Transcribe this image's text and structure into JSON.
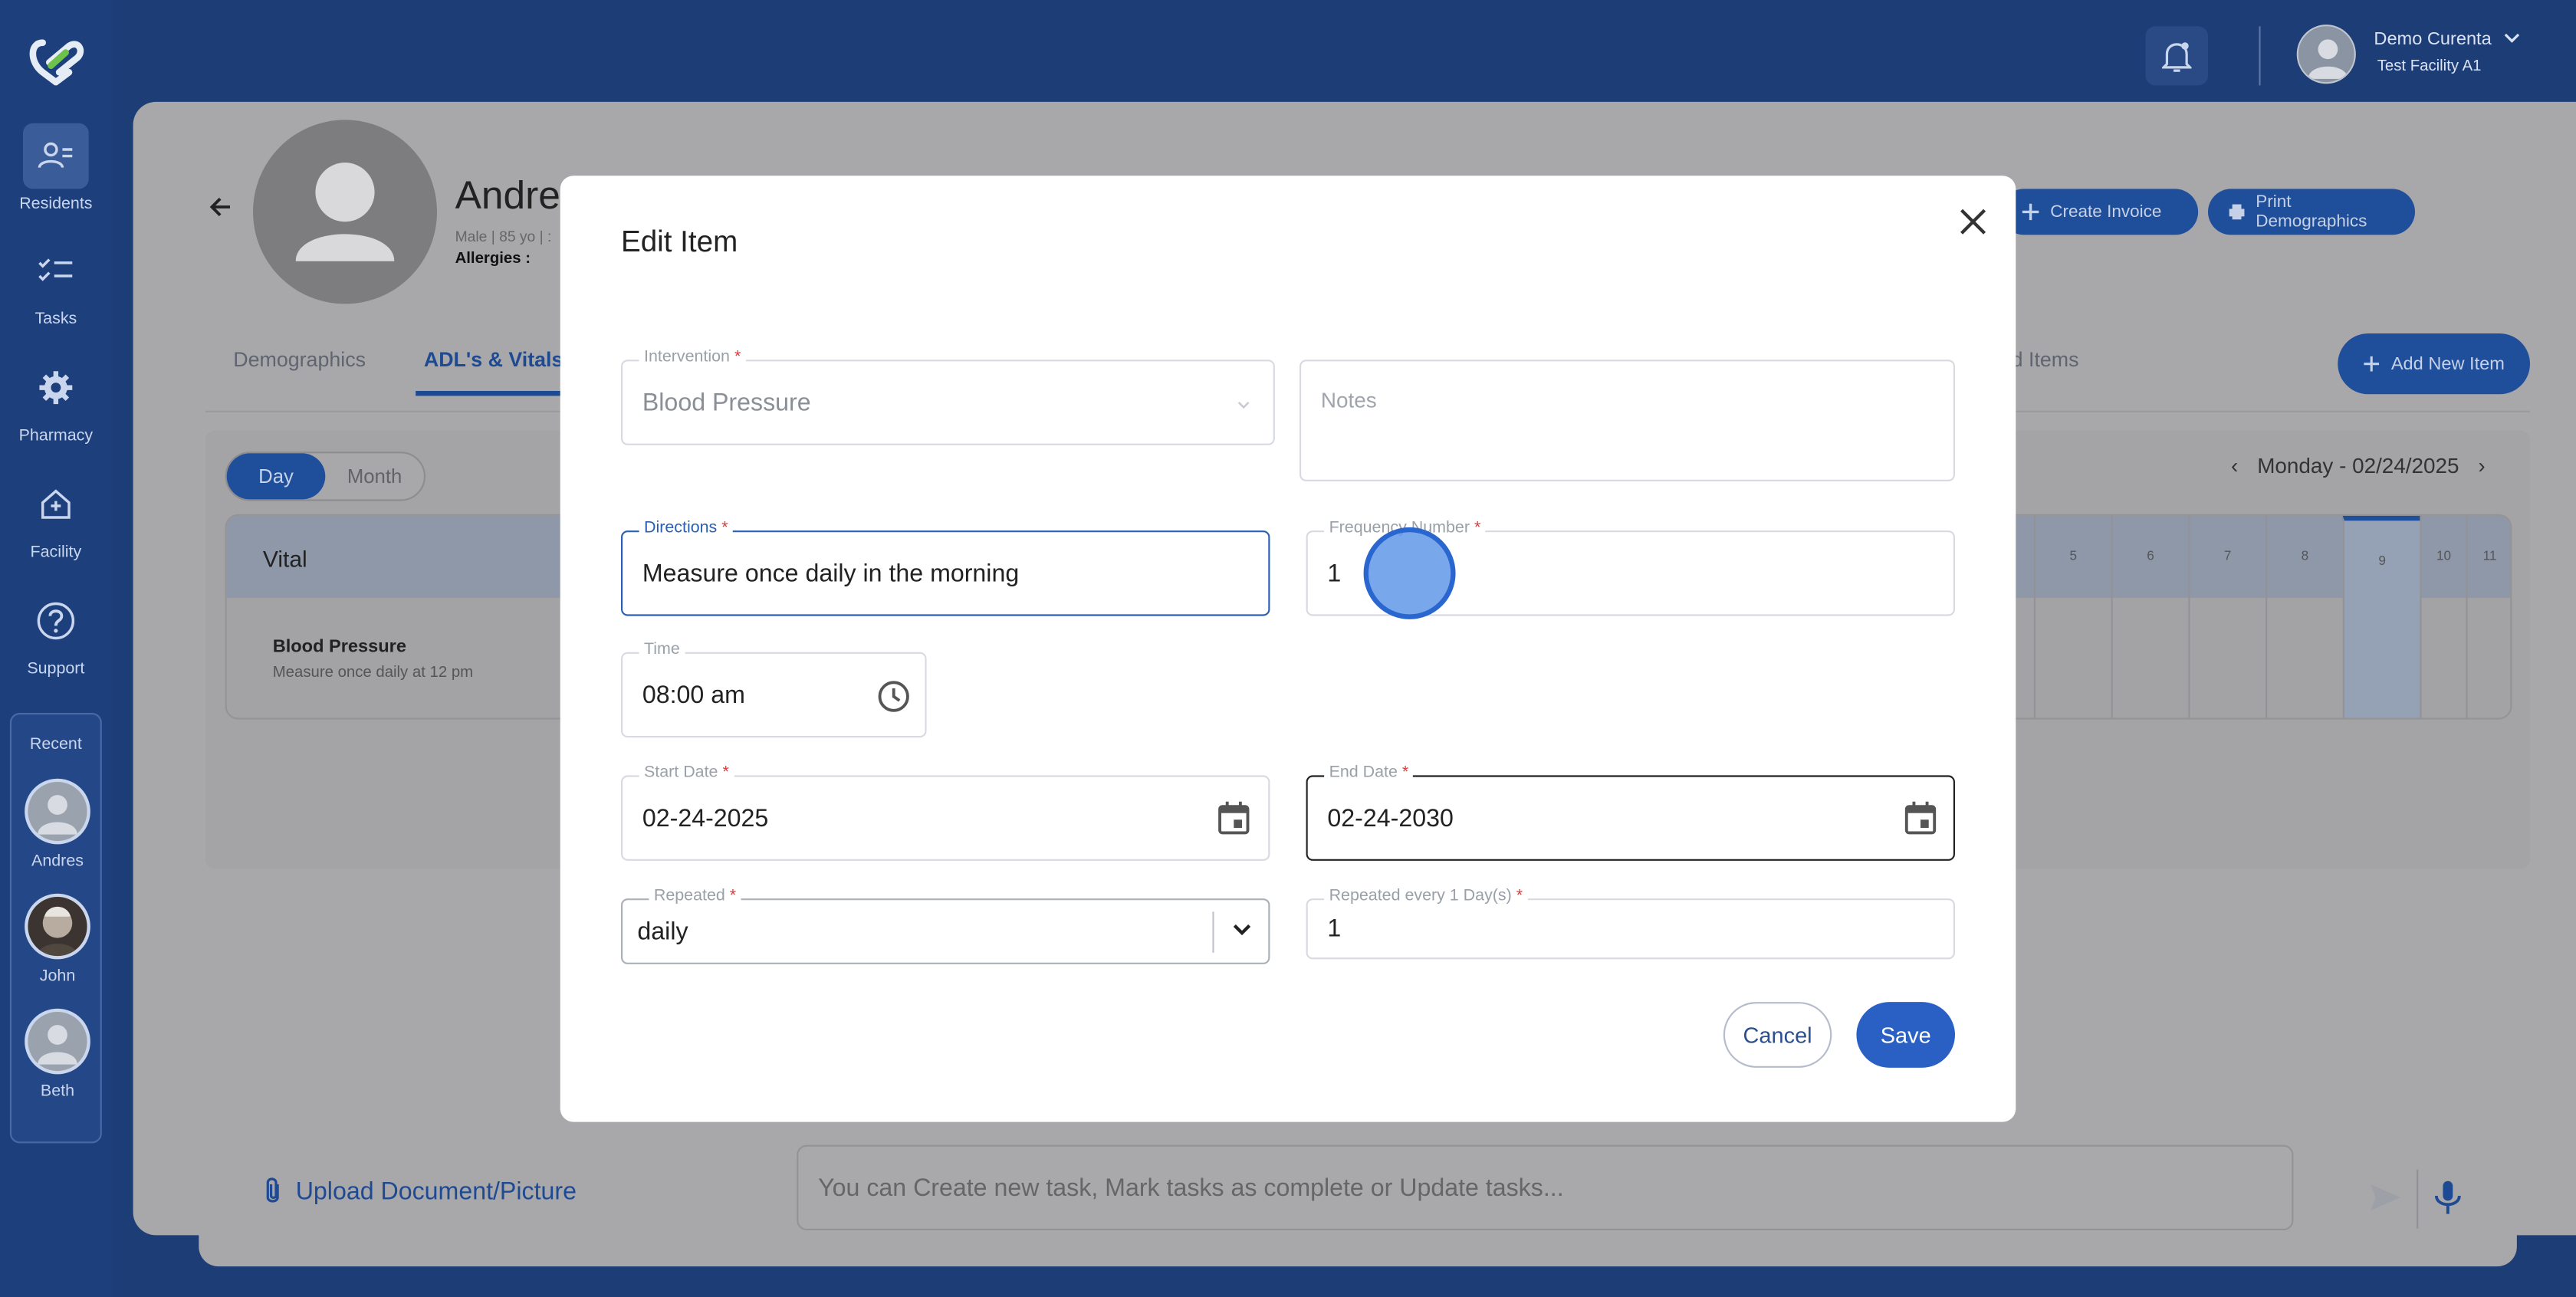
{
  "colors": {
    "sidebar": "#1d3f7c",
    "accent": "#2a60c4",
    "overlay_panel": "#a8a8aa"
  },
  "sidebar": {
    "items": [
      {
        "label": "Residents",
        "icon": "residents-icon"
      },
      {
        "label": "Tasks",
        "icon": "tasks-icon"
      },
      {
        "label": "Pharmacy",
        "icon": "gear-icon"
      },
      {
        "label": "Facility",
        "icon": "facility-icon"
      },
      {
        "label": "Support",
        "icon": "help-icon"
      }
    ],
    "recent": {
      "label": "Recent",
      "people": [
        "Andres",
        "John",
        "Beth"
      ]
    }
  },
  "header": {
    "user_name": "Demo Curenta",
    "facility": "Test Facility A1"
  },
  "resident": {
    "name": "Andres",
    "meta": "Male | 85 yo | :",
    "allergies_label": "Allergies :",
    "actions": {
      "create_invoice": "Create Invoice",
      "print_demographics": "Print Demographics"
    },
    "tabs": [
      "Demographics",
      "ADL's & Vitals"
    ],
    "completed_items": "eted Items",
    "add_new_item": "Add New Item",
    "view_toggle": {
      "day": "Day",
      "month": "Month"
    },
    "date_nav": "Monday - 02/24/2025",
    "table": {
      "header": "Vital",
      "hours": [
        "5",
        "6",
        "7",
        "8",
        "9",
        "10",
        "11"
      ],
      "row_title": "Blood Pressure",
      "row_sub": "Measure once daily at 12 pm"
    }
  },
  "bottom": {
    "upload_label": "Upload Document/Picture",
    "chat_placeholder": "You can Create new task, Mark tasks as complete or Update tasks..."
  },
  "modal": {
    "title": "Edit Item",
    "intervention": {
      "label": "Intervention",
      "value": "Blood Pressure"
    },
    "notes": {
      "placeholder": "Notes"
    },
    "directions": {
      "label": "Directions",
      "value": "Measure once daily in the morning"
    },
    "frequency": {
      "label": "Frequency Number",
      "value": "1"
    },
    "time": {
      "label": "Time",
      "value": "08:00 am"
    },
    "start_date": {
      "label": "Start Date",
      "value": "02-24-2025"
    },
    "end_date": {
      "label": "End Date",
      "value": "02-24-2030"
    },
    "repeated": {
      "label": "Repeated",
      "value": "daily"
    },
    "repeated_every": {
      "label": "Repeated every 1 Day(s)",
      "value": "1"
    },
    "cancel": "Cancel",
    "save": "Save"
  }
}
